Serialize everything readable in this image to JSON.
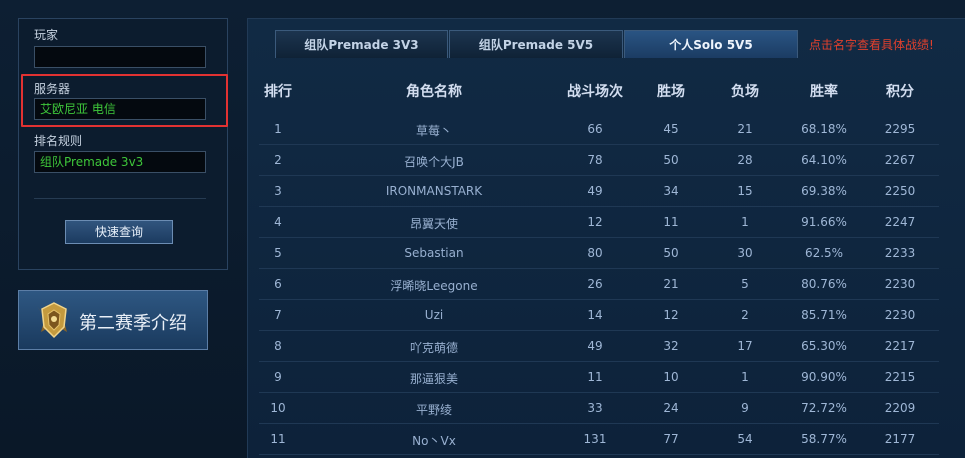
{
  "sidebar": {
    "player_label": "玩家",
    "player_value": "",
    "server_label": "服务器",
    "server_value": "艾欧尼亚 电信",
    "rule_label": "排名规则",
    "rule_value": "组队Premade 3v3",
    "query_button": "快速查询",
    "season_intro": "第二赛季介绍"
  },
  "tabs": [
    {
      "label": "组队Premade 3V3",
      "active": false
    },
    {
      "label": "组队Premade 5V5",
      "active": false
    },
    {
      "label": "个人Solo 5V5",
      "active": true
    }
  ],
  "tab_hint": "点击名字查看具体战绩!",
  "table": {
    "headers": {
      "rank": "排行",
      "name": "角色名称",
      "games": "战斗场次",
      "wins": "胜场",
      "losses": "负场",
      "winrate": "胜率",
      "score": "积分"
    },
    "rows": [
      {
        "rank": "1",
        "name": "草莓丶",
        "games": "66",
        "wins": "45",
        "losses": "21",
        "winrate": "68.18%",
        "score": "2295"
      },
      {
        "rank": "2",
        "name": "召唤个大JB",
        "games": "78",
        "wins": "50",
        "losses": "28",
        "winrate": "64.10%",
        "score": "2267"
      },
      {
        "rank": "3",
        "name": "IRONMANSTARK",
        "games": "49",
        "wins": "34",
        "losses": "15",
        "winrate": "69.38%",
        "score": "2250"
      },
      {
        "rank": "4",
        "name": "昂翼天使",
        "games": "12",
        "wins": "11",
        "losses": "1",
        "winrate": "91.66%",
        "score": "2247"
      },
      {
        "rank": "5",
        "name": "Sebastian",
        "games": "80",
        "wins": "50",
        "losses": "30",
        "winrate": "62.5%",
        "score": "2233"
      },
      {
        "rank": "6",
        "name": "浮晞晓Leegone",
        "games": "26",
        "wins": "21",
        "losses": "5",
        "winrate": "80.76%",
        "score": "2230"
      },
      {
        "rank": "7",
        "name": "Uzi",
        "games": "14",
        "wins": "12",
        "losses": "2",
        "winrate": "85.71%",
        "score": "2230"
      },
      {
        "rank": "8",
        "name": "吖克萌德",
        "games": "49",
        "wins": "32",
        "losses": "17",
        "winrate": "65.30%",
        "score": "2217"
      },
      {
        "rank": "9",
        "name": "那逼狠美",
        "games": "11",
        "wins": "10",
        "losses": "1",
        "winrate": "90.90%",
        "score": "2215"
      },
      {
        "rank": "10",
        "name": "平野绫",
        "games": "33",
        "wins": "24",
        "losses": "9",
        "winrate": "72.72%",
        "score": "2209"
      },
      {
        "rank": "11",
        "name": "No丶Vx",
        "games": "131",
        "wins": "77",
        "losses": "54",
        "winrate": "58.77%",
        "score": "2177"
      }
    ]
  },
  "icons": {
    "season_emblem": "gold-shield-emblem-icon"
  },
  "colors": {
    "background": "#0b1a2b",
    "accent_green": "#3ec63a",
    "hint_red": "#e0402d",
    "highlight_red": "#e23232"
  }
}
